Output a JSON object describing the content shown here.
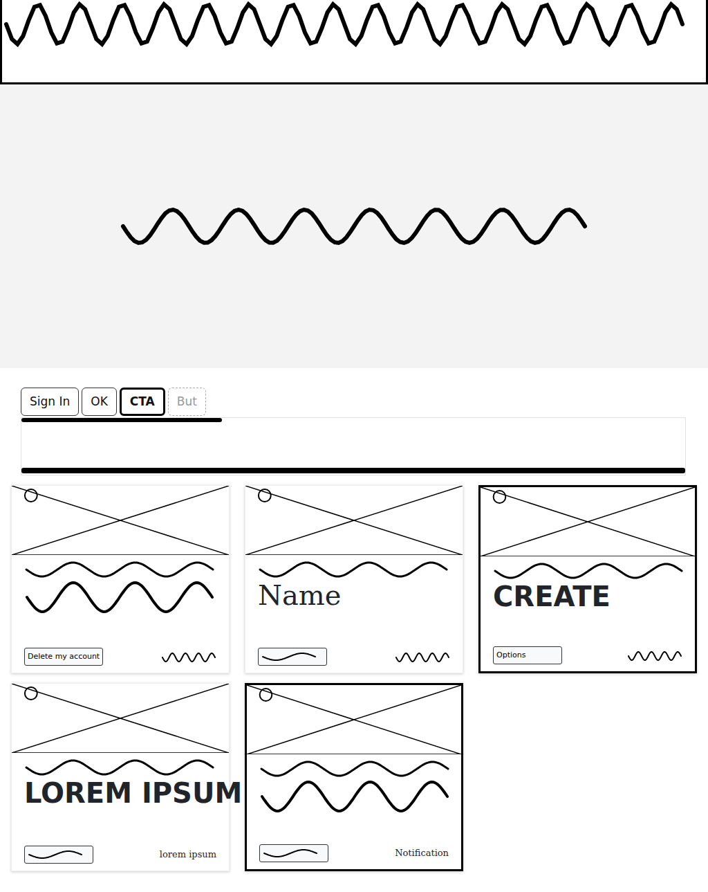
{
  "buttons": [
    {
      "label": "Sign In",
      "selected": false,
      "disabled": false
    },
    {
      "label": "OK",
      "selected": false,
      "disabled": false
    },
    {
      "label": "CTA",
      "selected": true,
      "disabled": false
    },
    {
      "label": "But",
      "selected": false,
      "disabled": true
    }
  ],
  "cards": [
    {
      "selected": false,
      "button": "Delete my account"
    },
    {
      "selected": false,
      "heading": "Name",
      "kind": "hand"
    },
    {
      "selected": true,
      "heading": "CREATE",
      "kind": "print",
      "button": "Options"
    },
    {
      "selected": false,
      "heading": "LOREM IPSUM",
      "kind": "print",
      "note": "lorem ipsum"
    },
    {
      "selected": true,
      "note": "Notification"
    }
  ]
}
